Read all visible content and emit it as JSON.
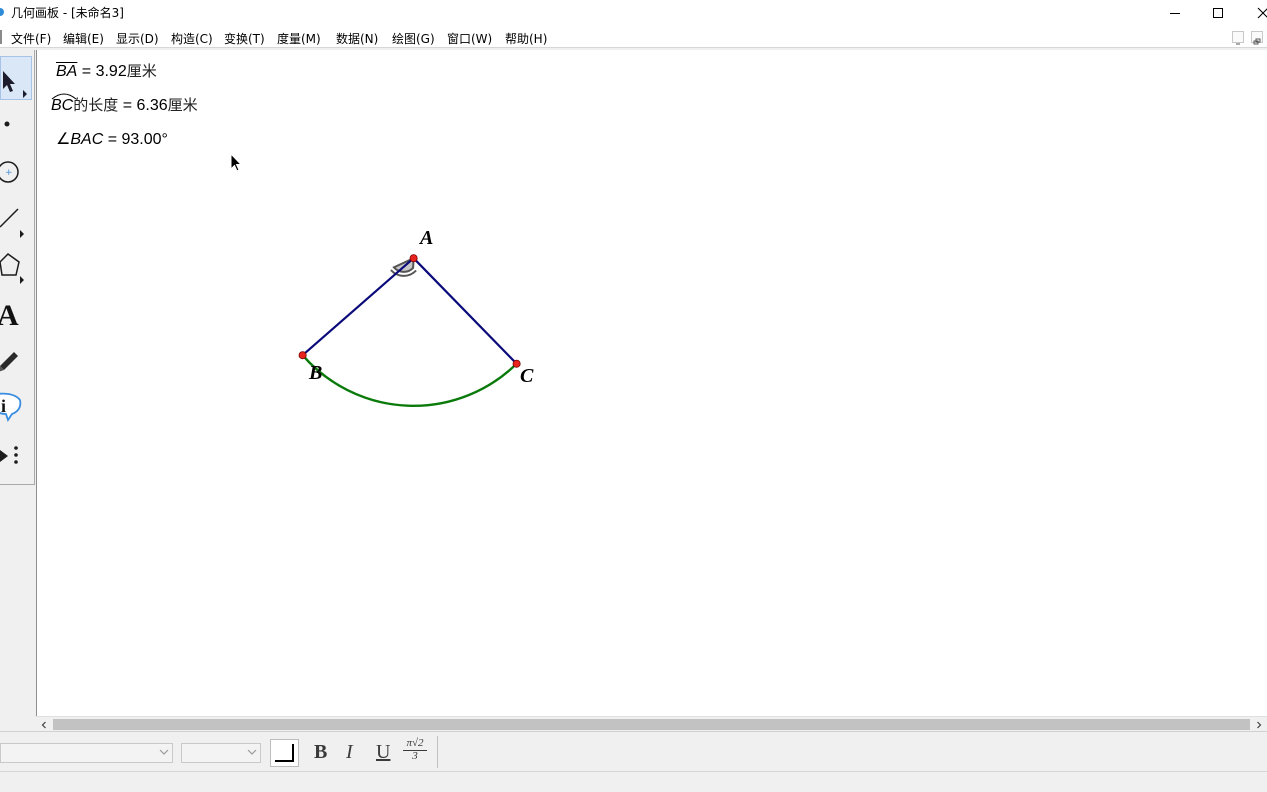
{
  "window": {
    "title": "几何画板 - [未命名3]"
  },
  "menu": {
    "items": [
      "文件(F)",
      "编辑(E)",
      "显示(D)",
      "构造(C)",
      "变换(T)",
      "度量(M)",
      "数据(N)",
      "绘图(G)",
      "窗口(W)",
      "帮助(H)"
    ]
  },
  "toolbox": {
    "tools": [
      "arrow-select-icon",
      "point-icon",
      "compass-icon",
      "straightedge-icon",
      "polygon-icon",
      "text-icon",
      "marker-pen-icon",
      "information-icon",
      "custom-tool-icon"
    ]
  },
  "measurements": {
    "ba": {
      "name": "BA",
      "equals": " = ",
      "value": "3.92",
      "unit": "厘米"
    },
    "bc": {
      "name": "BC",
      "suffix": "的长度",
      "equals": " = ",
      "value": "6.36",
      "unit": "厘米"
    },
    "angle": {
      "symbol": "∠",
      "name": "BAC",
      "equals": " = ",
      "value": "93.00°"
    }
  },
  "figure": {
    "points": {
      "a": "A",
      "b": "B",
      "c": "C"
    },
    "colors": {
      "segment": "#0a0a7a",
      "arc": "#0a7a0a",
      "point": "#e8231d",
      "angle_mark": "#555555"
    }
  },
  "textbar": {
    "bold": "B",
    "italic": "I",
    "underline": "U",
    "math_top": "π√2",
    "math_bottom": "3"
  }
}
